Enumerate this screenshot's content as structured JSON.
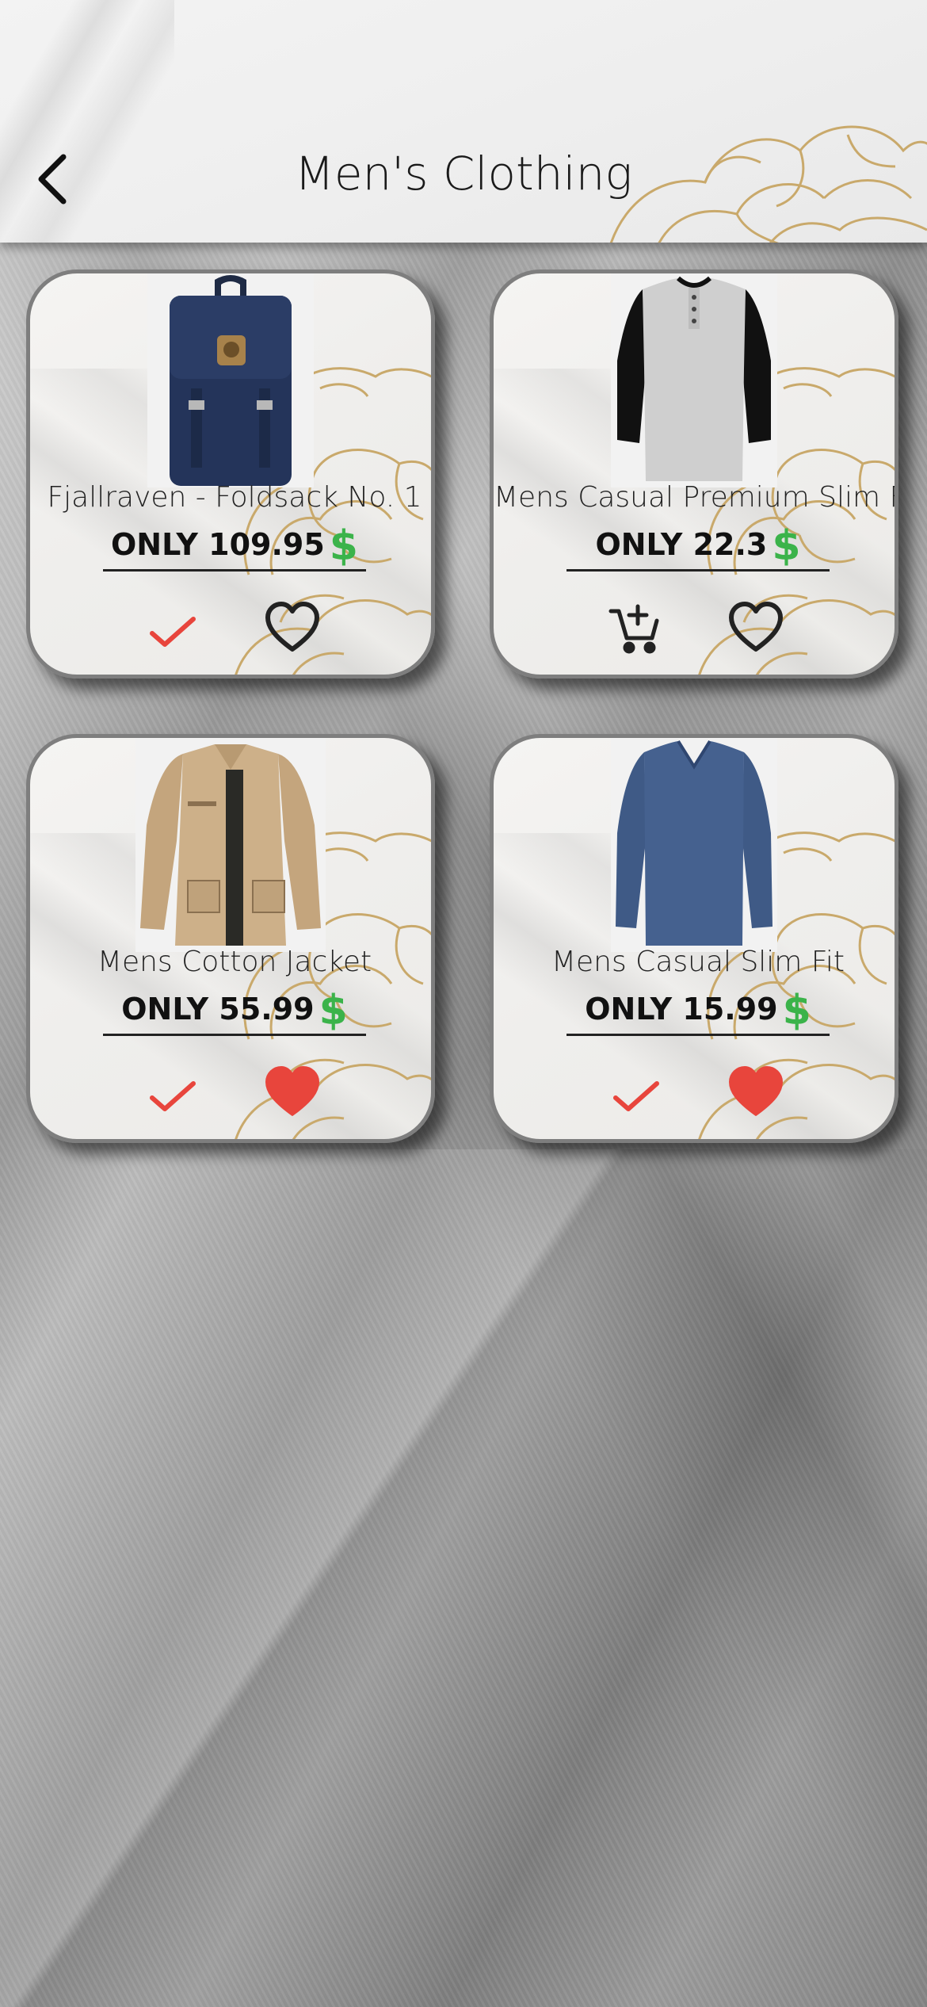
{
  "header": {
    "title": "Men's Clothing"
  },
  "products": [
    {
      "name": "Fjallraven - Foldsack No. 1",
      "price_prefix": "ONLY",
      "price": "109.95",
      "currency": "$",
      "action_icon": "check-icon",
      "favorite": false
    },
    {
      "name": "Mens Casual Premium Slim Fit",
      "price_prefix": "ONLY",
      "price": "22.3",
      "currency": "$",
      "action_icon": "add-to-cart-icon",
      "favorite": false
    },
    {
      "name": "Mens Cotton Jacket",
      "price_prefix": "ONLY",
      "price": "55.99",
      "currency": "$",
      "action_icon": "check-icon",
      "favorite": true
    },
    {
      "name": "Mens Casual Slim Fit",
      "price_prefix": "ONLY",
      "price": "15.99",
      "currency": "$",
      "action_icon": "check-icon",
      "favorite": true
    }
  ],
  "colors": {
    "check": "#e8453c",
    "heart_filled": "#e8453c",
    "dollar": "#3bb34a",
    "flower": "#c9a96b"
  }
}
